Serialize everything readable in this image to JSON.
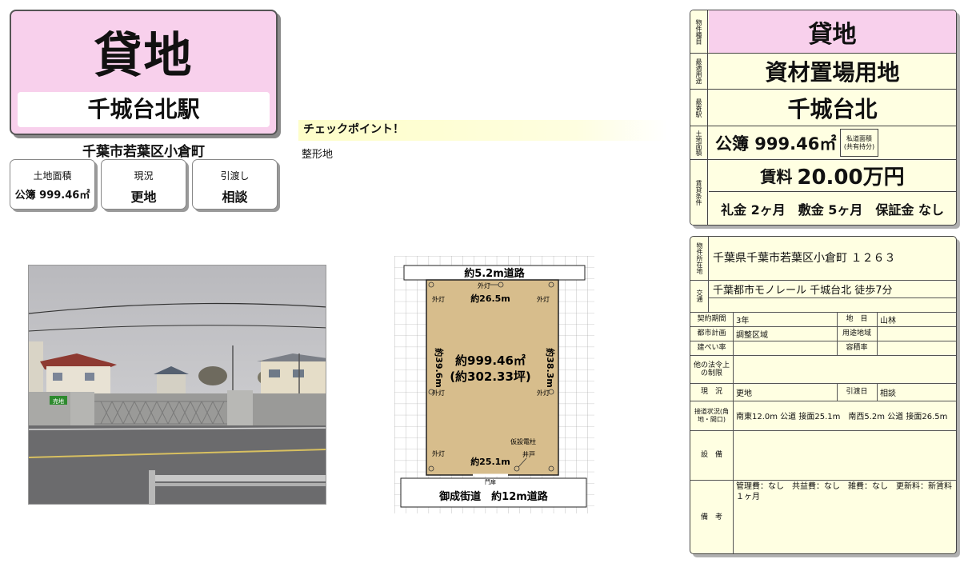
{
  "header": {
    "title": "貸地",
    "station": "千城台北駅",
    "address": "千葉市若葉区小倉町"
  },
  "stats": [
    {
      "label": "土地面積",
      "value": "公簿 999.46㎡"
    },
    {
      "label": "現況",
      "value": "更地"
    },
    {
      "label": "引渡し",
      "value": "相談"
    }
  ],
  "checkpoint": {
    "title": "チェックポイント！",
    "text": "整形地"
  },
  "photo": {
    "sign_text": "売地"
  },
  "plot": {
    "road_top": "約5.2m道路",
    "road_bottom": "御成街道　約12m道路",
    "top_edge": "約26.5m",
    "bottom_edge": "約25.1m",
    "left_edge": "約39.6m",
    "right_edge": "約38.3m",
    "area_m2": "約999.46㎡",
    "area_tsubo": "(約302.33坪)",
    "light_label": "外灯",
    "light_top": "外灯",
    "pole_label": "仮設電柱",
    "well_label": "井戸",
    "gate_label": "門扉"
  },
  "summary": {
    "type_label": "物件種目",
    "type_value": "貸地",
    "use_label": "最適用途",
    "use_value": "資材置場用地",
    "station_label": "最寄駅",
    "station_value": "千城台北",
    "area_label": "土地面積",
    "area_value": "公簿 999.46㎡",
    "private_road": "私道面積\n(共有持分)",
    "lease_label": "賃貸条件",
    "rent_prefix": "賃料",
    "rent_value": "20.00万円",
    "conditions": "礼金 2ヶ月　敷金 5ヶ月　保証金 なし"
  },
  "details": {
    "location_label": "物件所在地",
    "location_value": "千葉県千葉市若葉区小倉町 １２６３",
    "traffic_label": "交通",
    "traffic_value": "千葉都市モノレール 千城台北 徒歩7分",
    "contract_period_label": "契約期間",
    "contract_period_value": "3年",
    "land_category_label": "地　目",
    "land_category_value": "山林",
    "city_planning_label": "都市計画",
    "city_planning_value": "調整区域",
    "zoning_label": "用途地域",
    "zoning_value": "",
    "coverage_label": "建ぺい率",
    "coverage_value": "",
    "far_label": "容積率",
    "far_value": "",
    "other_law_label": "他の法令上の制限",
    "other_law_value": "",
    "status_label": "現　況",
    "status_value": "更地",
    "handover_label": "引渡日",
    "handover_value": "相談",
    "road_label": "接道状況(角地・間口)",
    "road_value": "南東12.0m 公道 接面25.1m　南西5.2m 公道 接面26.5m",
    "facilities_label": "設　備",
    "facilities_value": "",
    "remarks_label": "備　考",
    "remarks_value": "管理費：なし　共益費：なし　雑費：なし　更新料：新賃料１ヶ月"
  },
  "colors": {
    "pink": "#f8d0ec",
    "cream": "#ffffe2",
    "plot_fill": "#d7bd8c"
  }
}
